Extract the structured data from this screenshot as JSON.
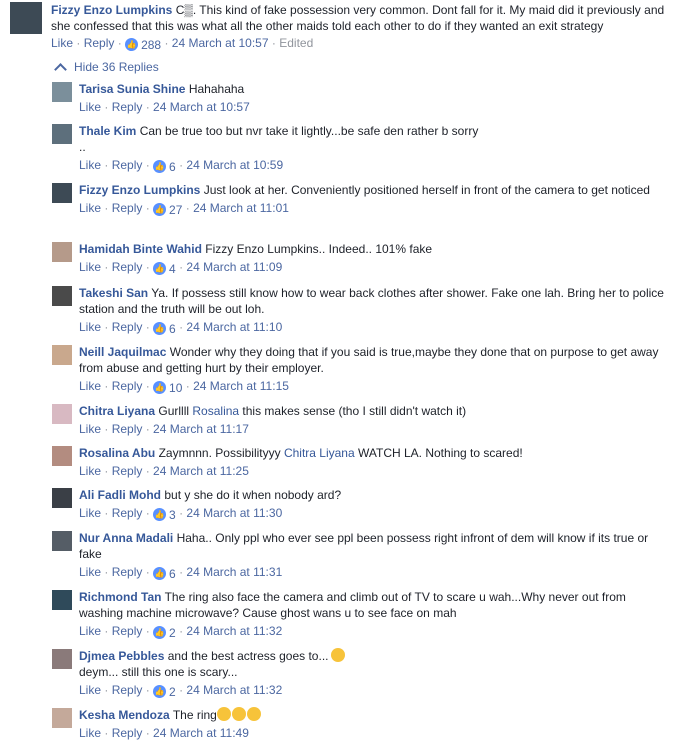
{
  "top_comment": {
    "author": "Fizzy Enzo Lumpkins",
    "text": "C▒. This kind of fake possession very common. Dont fall for it. My maid did it previously and she confessed that this was what all the other maids told each other to do if they wanted an exit strategy",
    "like_label": "Like",
    "reply_label": "Reply",
    "likes": "288",
    "time": "24 March at 10:57",
    "edited": "Edited"
  },
  "hide_replies": "Hide 36 Replies",
  "replies": [
    {
      "author": "Tarisa Sunia Shine",
      "text": "Hahahaha",
      "likes": "",
      "time": "24 March at 10:57",
      "avatar_color": "#7b8f9b"
    },
    {
      "author": "Thale Kim",
      "text": "Can be true too but nvr take it lightly...be safe den rather b sorry",
      "text2": "..",
      "likes": "6",
      "time": "24 March at 10:59",
      "avatar_color": "#5d6f7c"
    },
    {
      "author": "Fizzy Enzo Lumpkins",
      "text": "Just look at her. Conveniently positioned herself in front of the camera to get noticed",
      "likes": "27",
      "time": "24 March at 11:01",
      "avatar_color": "#3d4a55"
    },
    {
      "author": "Hamidah Binte Wahid",
      "text": "Fizzy Enzo Lumpkins.. Indeed.. 101% fake",
      "likes": "4",
      "time": "24 March at 11:09",
      "avatar_color": "#b59a8a"
    },
    {
      "author": "Takeshi San",
      "text": "Ya. If possess still know how to wear back clothes after shower. Fake one lah. Bring her to police station and the truth will be out loh.",
      "likes": "6",
      "time": "24 March at 11:10",
      "avatar_color": "#4a4a4a"
    },
    {
      "author": "Neill Jaquilmac",
      "text": "Wonder why they doing that if you said is true,maybe they done that on purpose to get away from abuse and getting hurt by their employer.",
      "likes": "10",
      "time": "24 March at 11:15",
      "avatar_color": "#c9a88d"
    },
    {
      "author": "Chitra Liyana",
      "text_pre": "Gurllll",
      "mention": "Rosalina",
      "text_post": "this makes sense (tho I still didn't watch it)",
      "likes": "",
      "time": "24 March at 11:17",
      "avatar_color": "#d8b9c2"
    },
    {
      "author": "Rosalina Abu",
      "text_pre": "Zaymnnn. Possibilityyy",
      "mention": "Chitra Liyana",
      "text_post": "WATCH LA. Nothing to scared!",
      "likes": "",
      "time": "24 March at 11:25",
      "avatar_color": "#b38c80"
    },
    {
      "author": "Ali Fadli Mohd",
      "text": "but y she do it when nobody ard?",
      "likes": "3",
      "time": "24 March at 11:30",
      "avatar_color": "#3a3f46"
    },
    {
      "author": "Nur Anna Madali",
      "text": "Haha.. Only ppl who ever see ppl been possess right infront of dem will know if its true or fake",
      "likes": "6",
      "time": "24 March at 11:31",
      "avatar_color": "#555d66"
    },
    {
      "author": "Richmond Tan",
      "text": "The ring also face the camera and climb out of TV to scare u wah...Why never out from washing machine microwave? Cause ghost wans u to see face on mah",
      "likes": "2",
      "time": "24 March at 11:32",
      "avatar_color": "#2f4a5a"
    },
    {
      "author": "Djmea Pebbles",
      "text": "and the best actress goes to...",
      "text2": "deym... still this one is scary...",
      "likes": "2",
      "time": "24 March at 11:32",
      "avatar_color": "#8a7a7a"
    },
    {
      "author": "Kesha Mendoza",
      "text": "The ring",
      "likes": "",
      "time": "24 March at 11:49",
      "avatar_color": "#c4a99a"
    }
  ],
  "labels": {
    "like": "Like",
    "reply": "Reply"
  },
  "colors": {
    "link": "#365899",
    "meta": "#90949c",
    "like_badge": "#5890ff"
  }
}
